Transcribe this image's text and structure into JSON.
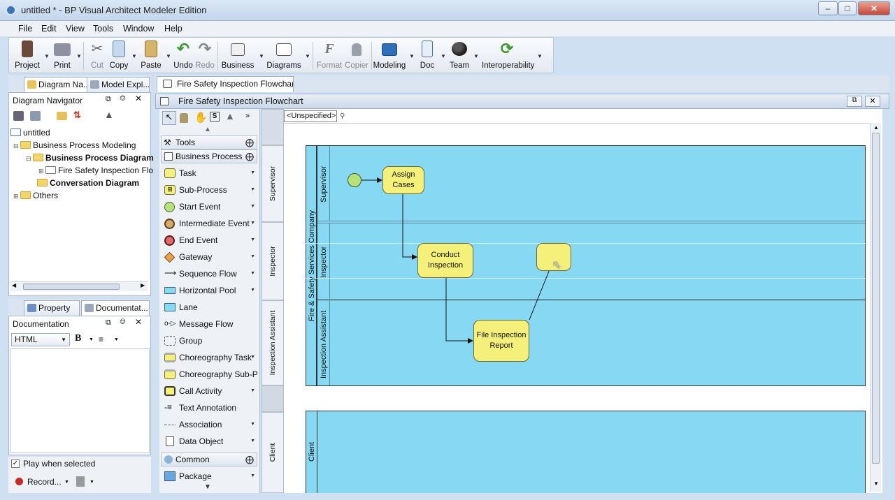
{
  "window": {
    "title": "untitled * - BP Visual Architect Modeler Edition"
  },
  "menu": [
    "File",
    "Edit",
    "View",
    "Tools",
    "Window",
    "Help"
  ],
  "toolbar": {
    "project": "Project",
    "print": "Print",
    "cut": "Cut",
    "copy": "Copy",
    "paste": "Paste",
    "undo": "Undo",
    "redo": "Redo",
    "business": "Business",
    "diagrams": "Diagrams",
    "format": "Format",
    "copier": "Copier",
    "modeling": "Modeling",
    "doc": "Doc",
    "team": "Team",
    "interoperability": "Interoperability"
  },
  "left_tabs": {
    "diagram_navigator": "Diagram Na...",
    "model_explorer": "Model Expl..."
  },
  "navigator": {
    "title": "Diagram Navigator",
    "tree": [
      "untitled",
      "Business Process Modeling",
      "Business Process Diagram",
      "Fire Safety Inspection Flo",
      "Conversation Diagram",
      "Others"
    ]
  },
  "lower_tabs": {
    "property": "Property",
    "documentation": "Documentat..."
  },
  "documentation": {
    "title": "Documentation",
    "format": "HTML",
    "bold": "B"
  },
  "bottom": {
    "play_when_selected": "Play when selected",
    "record": "Record..."
  },
  "editor_tab": "Fire Safety Inspection Flowchart",
  "diagram_title": "Fire Safety Inspection Flowchart",
  "palette": {
    "tools_header": "Tools",
    "business_process_header": "Business Process",
    "items": [
      "Task",
      "Sub-Process",
      "Start Event",
      "Intermediate Event",
      "End Event",
      "Gateway",
      "Sequence Flow",
      "Horizontal Pool",
      "Lane",
      "Message Flow",
      "Group",
      "Choreography Task",
      "Choreography Sub-Proc",
      "Call Activity",
      "Text Annotation",
      "Association",
      "Data Object"
    ],
    "common_header": "Common",
    "package": "Package"
  },
  "scope": "<Unspecified>",
  "lane_tabs": [
    "Supervisor",
    "Inspector",
    "Inspection Assistant",
    "Client"
  ],
  "pool": {
    "name": "Fire & Safety Services Company",
    "lanes": [
      "Supervisor",
      "Inspector",
      "Inspection Assistant"
    ],
    "second_pool_lane": "Client"
  },
  "tasks": {
    "assign_cases": "Assign Cases",
    "conduct_inspection": "Conduct Inspection",
    "file_report": "File Inspection Report",
    "new_task": ""
  },
  "colors": {
    "pool": "#87d8f2",
    "task": "#f4f07a",
    "start_event": "#b5e27a"
  }
}
